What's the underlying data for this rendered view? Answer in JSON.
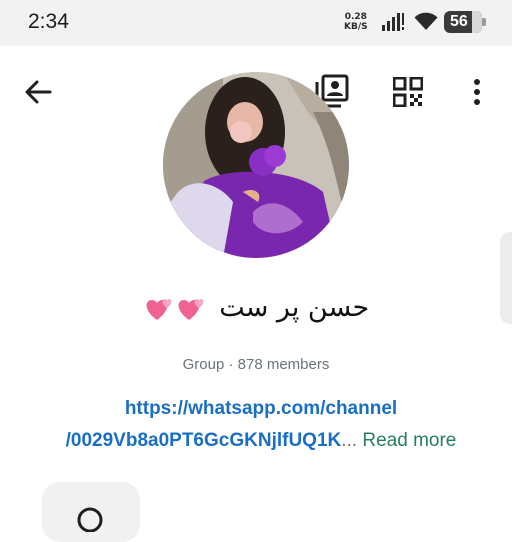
{
  "status_bar": {
    "time": "2:34",
    "net_speed_value": "0.28",
    "net_speed_unit": "KB/S",
    "battery": "56"
  },
  "top_bar": {
    "back_icon": "arrow-left-icon",
    "actions": [
      "albums-icon",
      "qr-code-icon",
      "more-vertical-icon"
    ]
  },
  "profile": {
    "name": "حسن پر ست",
    "name_emoji": "💞💞",
    "subtitle": "Group · 878 members",
    "description_link_line1": "https://whatsapp.com/channel",
    "description_link_line2": "/0029Vb8a0PT6GcGKNjlfUQ1K",
    "ellipsis": "...",
    "read_more": "Read more"
  },
  "colors": {
    "link": "#1a6fc4",
    "accent_green": "#25805b",
    "muted": "#6b7478",
    "status_bg": "#f2f2f2"
  }
}
